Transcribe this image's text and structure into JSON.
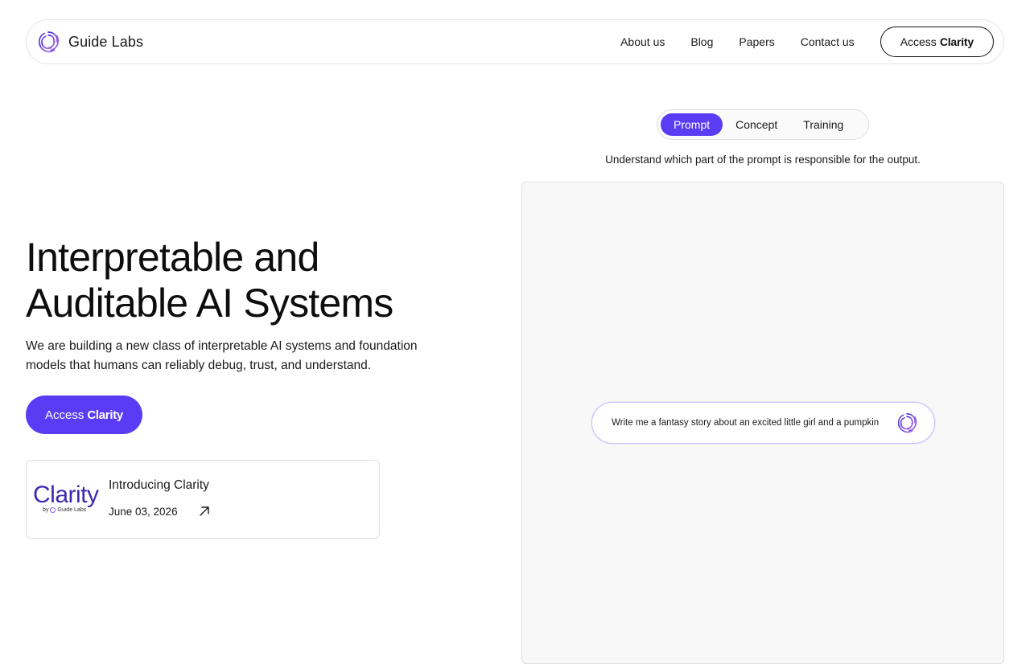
{
  "nav": {
    "brand": "Guide Labs",
    "links": [
      "About us",
      "Blog",
      "Papers",
      "Contact us"
    ],
    "cta_prefix": "Access",
    "cta_bold": "Clarity"
  },
  "hero": {
    "title_line1": "Interpretable and",
    "title_line2": "Auditable AI Systems",
    "subtitle": "We are building a new class of interpretable AI systems and foundation models that humans can reliably debug, trust, and understand.",
    "cta_prefix": "Access",
    "cta_bold": "Clarity"
  },
  "post": {
    "thumb_word": "Clarity",
    "thumb_by": "by",
    "thumb_brand": "Guide Labs",
    "title": "Introducing Clarity",
    "date": "June 03, 2026"
  },
  "demo": {
    "tabs": [
      "Prompt",
      "Concept",
      "Training"
    ],
    "active_tab": "Prompt",
    "description": "Understand which part of the prompt is responsible for the output.",
    "prompt_text": "Write me a fantasy story about an excited little girl and a pumpkin"
  },
  "colors": {
    "accent": "#5b3cf5",
    "logo_gradient_start": "#3b2bd8",
    "logo_gradient_end": "#b06ee8"
  },
  "icons": {
    "brand_logo": "spiral-logo-icon",
    "post_arrow": "arrow-up-right-icon"
  }
}
